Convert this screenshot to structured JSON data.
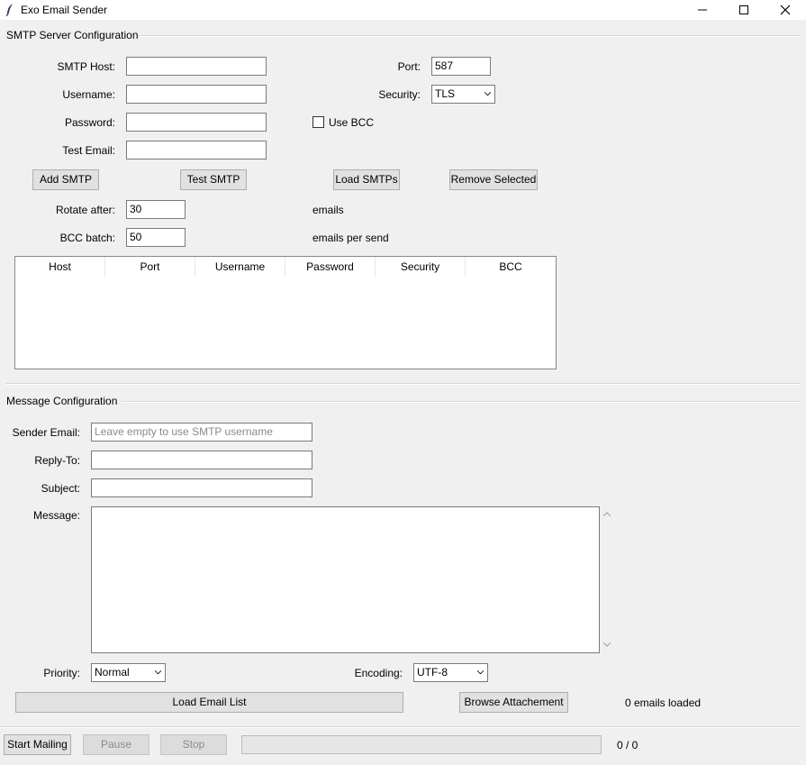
{
  "window": {
    "title": "Exo Email Sender",
    "minimize_icon": "minimize-icon",
    "maximize_icon": "maximize-icon",
    "close_icon": "close-icon"
  },
  "smtp": {
    "section_title": "SMTP Server Configuration",
    "host_label": "SMTP Host:",
    "host_value": "",
    "username_label": "Username:",
    "username_value": "",
    "password_label": "Password:",
    "password_value": "",
    "test_email_label": "Test Email:",
    "test_email_value": "",
    "port_label": "Port:",
    "port_value": "587",
    "security_label": "Security:",
    "security_value": "TLS",
    "use_bcc_label": "Use BCC",
    "use_bcc_checked": false,
    "add_button": "Add SMTP",
    "test_button": "Test SMTP",
    "load_button": "Load SMTPs",
    "remove_button": "Remove Selected",
    "rotate_label": "Rotate after:",
    "rotate_value": "30",
    "rotate_unit": "emails",
    "bcc_batch_label": "BCC batch:",
    "bcc_batch_value": "50",
    "bcc_batch_unit": "emails per send",
    "table": {
      "columns": [
        "Host",
        "Port",
        "Username",
        "Password",
        "Security",
        "BCC"
      ],
      "rows": []
    }
  },
  "message": {
    "section_title": "Message Configuration",
    "sender_label": "Sender Email:",
    "sender_value": "",
    "sender_placeholder": "Leave empty to use SMTP username",
    "reply_to_label": "Reply-To:",
    "reply_to_value": "",
    "subject_label": "Subject:",
    "subject_value": "",
    "message_label": "Message:",
    "message_value": "",
    "priority_label": "Priority:",
    "priority_value": "Normal",
    "encoding_label": "Encoding:",
    "encoding_value": "UTF-8",
    "load_list_button": "Load Email List",
    "browse_button": "Browse Attachement",
    "emails_loaded": "0 emails loaded"
  },
  "controls": {
    "start_button": "Start Mailing",
    "pause_button": "Pause",
    "stop_button": "Stop",
    "progress_fraction": 0,
    "progress_text": "0 / 0"
  }
}
